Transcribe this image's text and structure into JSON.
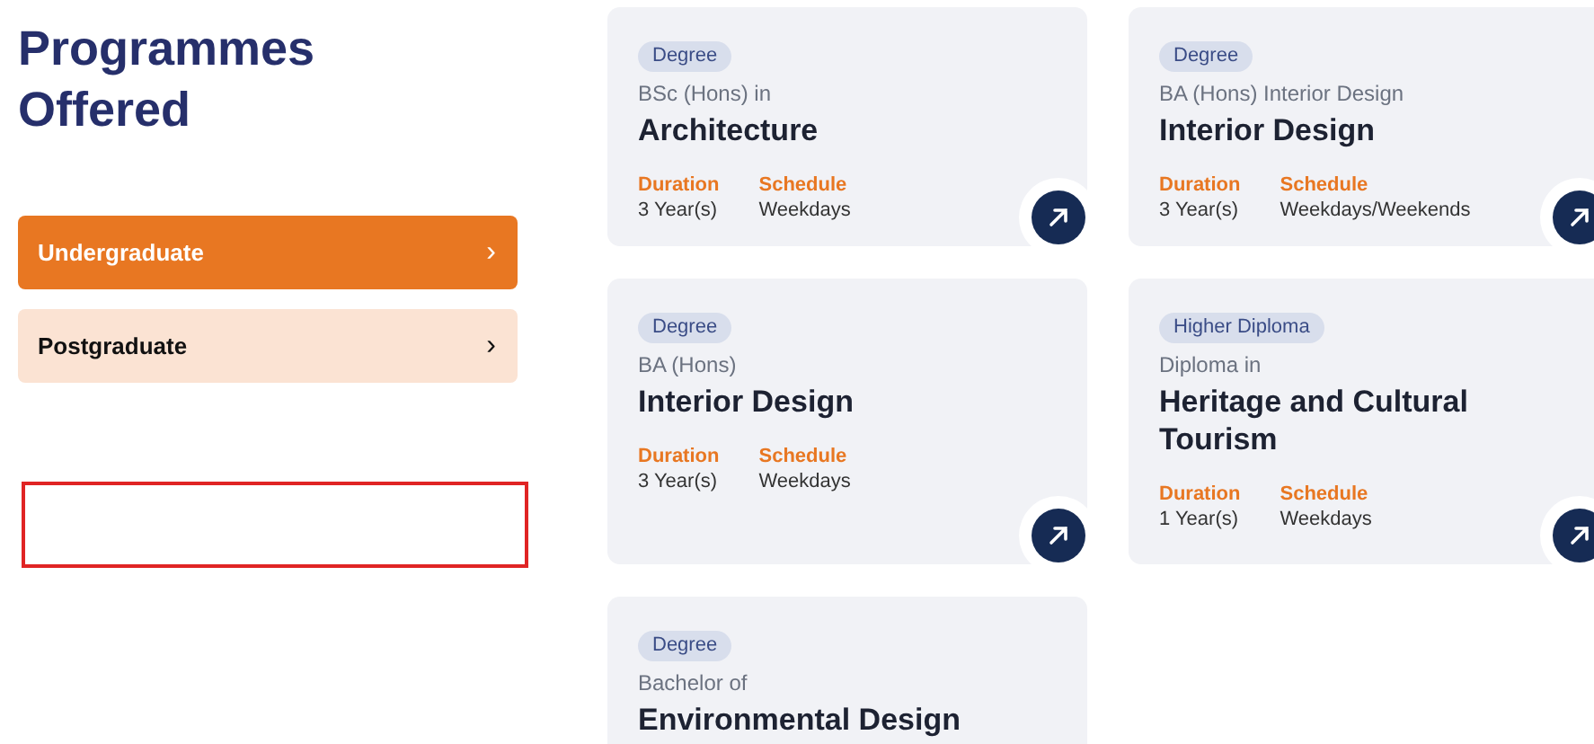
{
  "heading": "Programmes Offered",
  "levels": [
    {
      "label": "Undergraduate",
      "chevron": "›",
      "selected": true
    },
    {
      "label": "Postgraduate",
      "chevron": "›",
      "selected": false
    }
  ],
  "programmes": [
    {
      "badge": "Degree",
      "subtitle": "BSc (Hons) in",
      "title": "Architecture",
      "duration_label": "Duration",
      "duration": "3 Year(s)",
      "schedule_label": "Schedule",
      "schedule": "Weekdays"
    },
    {
      "badge": "Degree",
      "subtitle": "BA (Hons) Interior Design",
      "title": "Interior Design",
      "duration_label": "Duration",
      "duration": "3 Year(s)",
      "schedule_label": "Schedule",
      "schedule": "Weekdays/Weekends"
    },
    {
      "badge": "Degree",
      "subtitle": "BA (Hons)",
      "title": "Interior Design",
      "duration_label": "Duration",
      "duration": "3 Year(s)",
      "schedule_label": "Schedule",
      "schedule": "Weekdays"
    },
    {
      "badge": "Higher Diploma",
      "subtitle": "Diploma in",
      "title": "Heritage and Cultural Tourism",
      "duration_label": "Duration",
      "duration": "1 Year(s)",
      "schedule_label": "Schedule",
      "schedule": "Weekdays"
    },
    {
      "badge": "Degree",
      "subtitle": "Bachelor of",
      "title": "Environmental Design"
    }
  ]
}
